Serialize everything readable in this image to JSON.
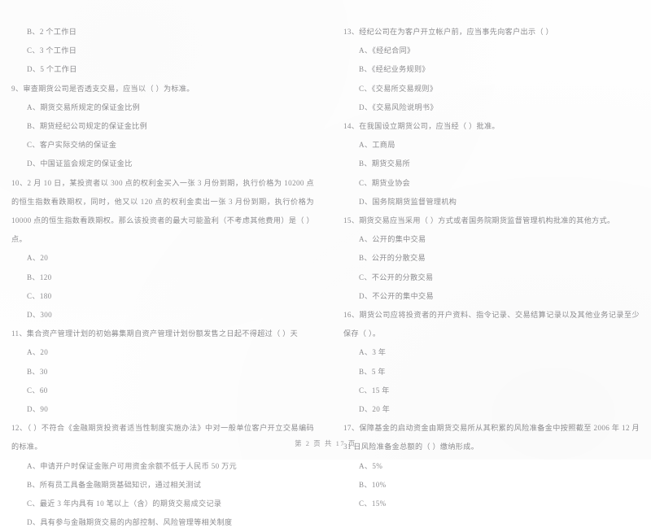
{
  "document": {
    "footer": "第 2 页  共 17 页"
  },
  "left_column": {
    "items": [
      {
        "kind": "option",
        "text": "B、2 个工作日"
      },
      {
        "kind": "option",
        "text": "C、3 个工作日"
      },
      {
        "kind": "option",
        "text": "D、5 个工作日"
      },
      {
        "kind": "question",
        "text": "9、审查期货公司是否透支交易，应当以（      ）为标准。"
      },
      {
        "kind": "option",
        "text": "A、期货交易所规定的保证金比例"
      },
      {
        "kind": "option",
        "text": "B、期货经纪公司规定的保证金比例"
      },
      {
        "kind": "option",
        "text": "C、客户实际交纳的保证金"
      },
      {
        "kind": "option",
        "text": "D、中国证监会规定的保证金比"
      },
      {
        "kind": "question",
        "text": "10、2 月 10 日，某投资者以 300 点的权利金买入一张 3 月份到期，执行价格为 10200 点的恒生指数看跌期权，同时，他又以 120 点的权利金卖出一张 3 月份到期，执行价格为 10000 点的恒生指数看跌期权。那么该投资者的最大可能盈利（不考虑其他费用）是（      ）点。"
      },
      {
        "kind": "option",
        "text": "A、20"
      },
      {
        "kind": "option",
        "text": "B、120"
      },
      {
        "kind": "option",
        "text": "C、180"
      },
      {
        "kind": "option",
        "text": "D、300"
      },
      {
        "kind": "question",
        "text": "11、集合资产管理计划的初始募集期自资产管理计划份额发售之日起不得超过（      ）天"
      },
      {
        "kind": "option",
        "text": "A、20"
      },
      {
        "kind": "option",
        "text": "B、30"
      },
      {
        "kind": "option",
        "text": "C、60"
      },
      {
        "kind": "option",
        "text": "D、90"
      },
      {
        "kind": "question",
        "text": "12、（      ）不符合《金融期货投资者适当性制度实施办法》中对一般单位客户开立交易编码的标准。"
      },
      {
        "kind": "option",
        "text": "A、申请开户时保证金账户可用资金余额不低于人民币 50 万元"
      },
      {
        "kind": "option",
        "text": "B、所有员工具备金融期货基础知识，通过相关测试"
      },
      {
        "kind": "option",
        "text": "C、最近 3 年内具有 10 笔以上（含）的期货交易成交记录"
      },
      {
        "kind": "option",
        "text": "D、具有参与金融期货交易的内部控制、风险管理等相关制度"
      }
    ]
  },
  "right_column": {
    "items": [
      {
        "kind": "question",
        "text": "13、经纪公司在为客户开立帐户前，应当事先向客户出示（      ）"
      },
      {
        "kind": "option",
        "text": "A、《经纪合同》"
      },
      {
        "kind": "option",
        "text": "B、《经纪业务规则》"
      },
      {
        "kind": "option",
        "text": "C、《交易所交易规则》"
      },
      {
        "kind": "option",
        "text": "D、《交易风险说明书》"
      },
      {
        "kind": "question",
        "text": "14、在我国设立期货公司，应当经（      ）批准。"
      },
      {
        "kind": "option",
        "text": "A、工商局"
      },
      {
        "kind": "option",
        "text": "B、期货交易所"
      },
      {
        "kind": "option",
        "text": "C、期货业协会"
      },
      {
        "kind": "option",
        "text": "D、国务院期货监督管理机构"
      },
      {
        "kind": "question",
        "text": "15、期货交易应当采用（      ）方式或者国务院期货监督管理机构批准的其他方式。"
      },
      {
        "kind": "option",
        "text": "A、公开的集中交易"
      },
      {
        "kind": "option",
        "text": "B、公开的分散交易"
      },
      {
        "kind": "option",
        "text": "C、不公开的分散交易"
      },
      {
        "kind": "option",
        "text": "D、不公开的集中交易"
      },
      {
        "kind": "question",
        "text": "16、期货公司应将投资者的开户资料、指令记录、交易结算记录以及其他业务记录至少保存（      ）。"
      },
      {
        "kind": "option",
        "text": "A、3 年"
      },
      {
        "kind": "option",
        "text": "B、5 年"
      },
      {
        "kind": "option",
        "text": "C、15 年"
      },
      {
        "kind": "option",
        "text": "D、20 年"
      },
      {
        "kind": "question",
        "text": "17、保障基金的启动资金由期货交易所从其积累的风险准备金中按照截至 2006 年 12 月 31 日风险准备金总额的（      ）缴纳形成。"
      },
      {
        "kind": "option",
        "text": "A、5%"
      },
      {
        "kind": "option",
        "text": "B、10%"
      },
      {
        "kind": "option",
        "text": "C、15%"
      }
    ]
  }
}
